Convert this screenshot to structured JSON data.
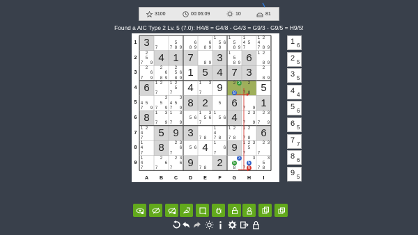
{
  "status": {
    "score": "3100",
    "timer": "00:06:09",
    "hints": "10",
    "rating": "81",
    "icons": [
      "star-icon",
      "clock-icon",
      "lightbulb-icon",
      "difficulty-icon"
    ]
  },
  "headline": "Found a AIC Type 2 Lv. 5 (7.0): H4/8 = G4/8 - G4/3 = G9/3 - G9/5 = H9/5!",
  "rows": [
    "1",
    "2",
    "3",
    "4",
    "5",
    "6",
    "7",
    "8",
    "9"
  ],
  "cols": [
    "A",
    "B",
    "C",
    "D",
    "E",
    "F",
    "G",
    "H",
    "I"
  ],
  "grid": [
    [
      {
        "v": "3",
        "g": true
      },
      {
        "c": "7"
      },
      {
        "c": "5789"
      },
      {
        "c": "689"
      },
      {
        "c": "689"
      },
      {
        "c": "1568"
      },
      {
        "c": "1589"
      },
      {
        "c": "1457"
      },
      {
        "c": "124789"
      }
    ],
    [
      {
        "c": "2579"
      },
      {
        "v": "4",
        "g": true
      },
      {
        "v": "1",
        "g": true
      },
      {
        "v": "7",
        "g": true
      },
      {
        "c": "89"
      },
      {
        "v": "3",
        "g": true
      },
      {
        "c": "1589"
      },
      {
        "v": "6",
        "g": true
      },
      {
        "c": "1289"
      }
    ],
    [
      {
        "c": "2679"
      },
      {
        "c": "2689"
      },
      {
        "c": "25689"
      },
      {
        "v": "1"
      },
      {
        "v": "5",
        "g": true
      },
      {
        "v": "4",
        "g": true
      },
      {
        "v": "7",
        "g": true
      },
      {
        "v": "3",
        "g": true
      },
      {
        "c": "289"
      }
    ],
    [
      {
        "v": "6",
        "g": true
      },
      {
        "c": "127"
      },
      {
        "c": "1257"
      },
      {
        "v": "4"
      },
      {
        "c": "137"
      },
      {
        "v": "9"
      },
      {
        "c": "238",
        "sel": true
      },
      {
        "c": "278",
        "sel": true
      },
      {
        "v": "5"
      }
    ],
    [
      {
        "c": "4579"
      },
      {
        "c": "3579"
      },
      {
        "c": "34579"
      },
      {
        "v": "8",
        "g": true
      },
      {
        "v": "2",
        "g": true
      },
      {
        "c": "5"
      },
      {
        "v": "6",
        "g": true
      },
      {
        "c": "79"
      },
      {
        "v": "1",
        "g": true
      }
    ],
    [
      {
        "v": "8",
        "g": true
      },
      {
        "c": "1379"
      },
      {
        "c": "1379"
      },
      {
        "c": "56"
      },
      {
        "c": "13567"
      },
      {
        "c": "156"
      },
      {
        "v": "4",
        "g": true
      },
      {
        "c": "2379"
      },
      {
        "c": "2379"
      }
    ],
    [
      {
        "c": "1247"
      },
      {
        "v": "5",
        "g": true
      },
      {
        "v": "9",
        "g": true
      },
      {
        "v": "3",
        "g": true
      },
      {
        "c": "78"
      },
      {
        "c": "1478"
      },
      {
        "c": "1278"
      },
      {
        "c": "1278"
      },
      {
        "v": "6",
        "g": true
      }
    ],
    [
      {
        "c": "147"
      },
      {
        "v": "8",
        "g": true
      },
      {
        "c": "2367"
      },
      {
        "c": "56"
      },
      {
        "v": "4"
      },
      {
        "c": "167"
      },
      {
        "v": "9",
        "g": true
      },
      {
        "c": "12357"
      },
      {
        "c": "237"
      }
    ],
    [
      {
        "c": "147"
      },
      {
        "c": "267"
      },
      {
        "c": "2367"
      },
      {
        "v": "9",
        "g": true
      },
      {
        "c": "78"
      },
      {
        "v": "2",
        "g": true
      },
      {
        "c": "358"
      },
      {
        "c": "3578"
      },
      {
        "c": "3578"
      }
    ]
  ],
  "highlights": [
    {
      "r": 3,
      "c": 6,
      "d": "3",
      "k": "green"
    },
    {
      "r": 3,
      "c": 6,
      "d": "8",
      "k": "blue"
    },
    {
      "r": 8,
      "c": 6,
      "d": "3",
      "k": "blue"
    },
    {
      "r": 8,
      "c": 6,
      "d": "5",
      "k": "green"
    },
    {
      "r": 8,
      "c": 7,
      "d": "5",
      "k": "blue"
    },
    {
      "r": 8,
      "c": 7,
      "d": "8",
      "k": "red"
    }
  ],
  "digit_buttons": [
    {
      "digit": "1",
      "count": "6"
    },
    {
      "digit": "2",
      "count": "5"
    },
    {
      "digit": "3",
      "count": "5"
    },
    {
      "digit": "4",
      "count": "4"
    },
    {
      "digit": "5",
      "count": "6"
    },
    {
      "digit": "6",
      "count": "5"
    },
    {
      "digit": "7",
      "count": "7"
    },
    {
      "digit": "8",
      "count": "6"
    },
    {
      "digit": "9",
      "count": "5"
    }
  ],
  "tools": [
    "show-candidates-icon",
    "hide-candidates-icon",
    "toggle-candidates-icon",
    "fill-candidates-icon",
    "clear-cell-icon",
    "bug-icon",
    "lock-icon",
    "highlight-icon",
    "copy-icon",
    "layers-icon"
  ],
  "bottom_icons": [
    "reset-icon",
    "undo-icon",
    "redo-icon",
    "hint-icon",
    "info-icon",
    "settings-icon",
    "exit-icon",
    "lock-icon"
  ],
  "colors": {
    "background": "#39404b",
    "tool_green": "#62a91c",
    "given_cell": "#d6d6d6",
    "selected_cell": "#9eaf5a",
    "chain_red": "#d8362e"
  }
}
